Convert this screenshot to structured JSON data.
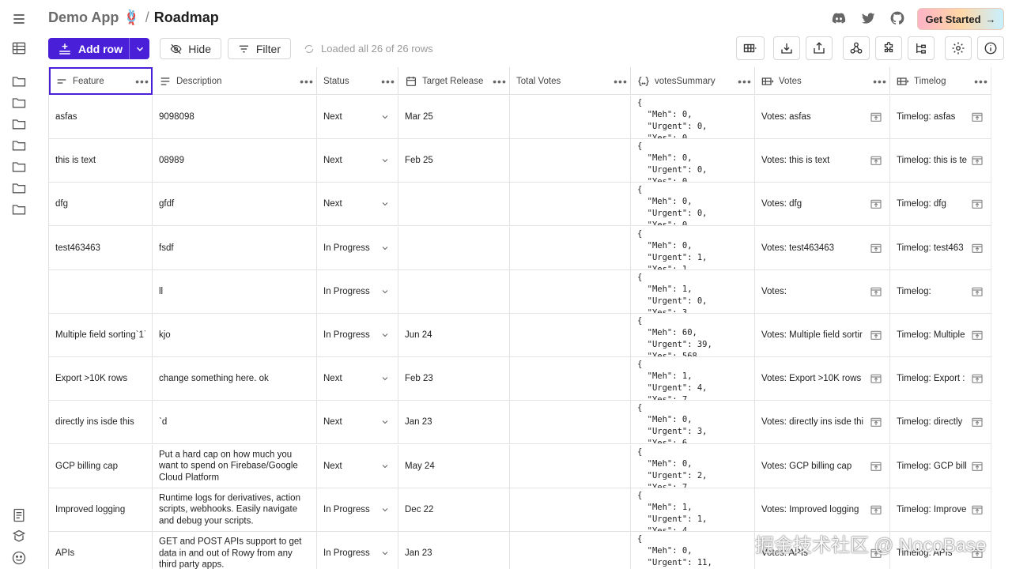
{
  "header": {
    "app_name": "Demo App 🪢",
    "separator": "/",
    "page_title": "Roadmap",
    "get_started_label": "Get Started",
    "icons": [
      "discord-icon",
      "twitter-icon",
      "github-icon"
    ]
  },
  "toolbar": {
    "add_row_label": "Add row",
    "hide_label": "Hide",
    "filter_label": "Filter",
    "loaded_text": "Loaded all 26 of 26 rows"
  },
  "table": {
    "columns": [
      {
        "label": "Feature",
        "icon": "short-text-icon"
      },
      {
        "label": "Description",
        "icon": "long-text-icon"
      },
      {
        "label": "Status",
        "icon": "none"
      },
      {
        "label": "Target Release",
        "icon": "calendar-icon"
      },
      {
        "label": "Total Votes",
        "icon": "none"
      },
      {
        "label": "votesSummary",
        "icon": "json-icon"
      },
      {
        "label": "Votes",
        "icon": "subtable-icon"
      },
      {
        "label": "Timelog",
        "icon": "subtable-icon"
      }
    ],
    "rows": [
      {
        "feature": "asfas",
        "description": "9098098",
        "status": "Next",
        "target": "Mar 25",
        "votes": "",
        "summary": "{\n  \"Meh\": 0,\n  \"Urgent\": 0,\n  \"Yes\": 0",
        "votes_cell": "Votes: asfas",
        "timelog": "Timelog: asfas"
      },
      {
        "feature": "this is text",
        "description": "08989",
        "status": "Next",
        "target": "Feb 25",
        "votes": "",
        "summary": "{\n  \"Meh\": 0,\n  \"Urgent\": 0,\n  \"Yes\": 0",
        "votes_cell": "Votes: this is text",
        "timelog": "Timelog: this is te"
      },
      {
        "feature": "dfg",
        "description": "gfdf",
        "status": "Next",
        "target": "",
        "votes": "",
        "summary": "{\n  \"Meh\": 0,\n  \"Urgent\": 0,\n  \"Yes\": 0",
        "votes_cell": "Votes: dfg",
        "timelog": "Timelog: dfg"
      },
      {
        "feature": "test463463",
        "description": "fsdf",
        "status": "In Progress",
        "target": "",
        "votes": "",
        "summary": "{\n  \"Meh\": 0,\n  \"Urgent\": 1,\n  \"Yes\": 1",
        "votes_cell": "Votes: test463463",
        "timelog": "Timelog: test463"
      },
      {
        "feature": "",
        "description": "ll",
        "status": "In Progress",
        "target": "",
        "votes": "",
        "summary": "{\n  \"Meh\": 1,\n  \"Urgent\": 0,\n  \"Yes\": 3",
        "votes_cell": "Votes:",
        "timelog": "Timelog:"
      },
      {
        "feature": "Multiple field sorting`1`",
        "description": "kjo",
        "status": "In Progress",
        "target": "Jun 24",
        "votes": "",
        "summary": "{\n  \"Meh\": 60,\n  \"Urgent\": 39,\n  \"Yes\": 568",
        "votes_cell": "Votes: Multiple field sortir",
        "timelog": "Timelog: Multiple"
      },
      {
        "feature": "Export >10K rows",
        "description": "change something here. ok",
        "status": "Next",
        "target": "Feb 23",
        "votes": "",
        "summary": "{\n  \"Meh\": 1,\n  \"Urgent\": 4,\n  \"Yes\": 7",
        "votes_cell": "Votes: Export >10K rows",
        "timelog": "Timelog: Export :"
      },
      {
        "feature": "directly ins isde this",
        "description": "`d",
        "status": "Next",
        "target": "Jan 23",
        "votes": "",
        "summary": "{\n  \"Meh\": 0,\n  \"Urgent\": 3,\n  \"Yes\": 6",
        "votes_cell": "Votes: directly ins isde thi",
        "timelog": "Timelog: directly"
      },
      {
        "feature": "GCP billing cap",
        "description": "Put a hard cap on how much you want to spend on Firebase/Google Cloud Platform",
        "status": "Next",
        "target": "May 24",
        "votes": "",
        "summary": "{\n  \"Meh\": 0,\n  \"Urgent\": 2,\n  \"Yes\": 7",
        "votes_cell": "Votes: GCP billing cap",
        "timelog": "Timelog: GCP bill"
      },
      {
        "feature": "Improved logging",
        "description": "Runtime logs for derivatives, action scripts, webhooks. Easily navigate and debug your scripts.",
        "status": "In Progress",
        "target": "Dec 22",
        "votes": "",
        "summary": "{\n  \"Meh\": 1,\n  \"Urgent\": 1,\n  \"Yes\": 4",
        "votes_cell": "Votes: Improved logging",
        "timelog": "Timelog: Improve"
      },
      {
        "feature": "APIs",
        "description": "GET and POST APIs support to get data in and out of Rowy from any third party apps.",
        "status": "In Progress",
        "target": "Jan 23",
        "votes": "",
        "summary": "{\n  \"Meh\": 0,\n  \"Urgent\": 11,",
        "votes_cell": "Votes: APIs",
        "timelog": "Timelog: APIs"
      }
    ]
  },
  "watermark": "掘金技术社区 @ NocoBase"
}
